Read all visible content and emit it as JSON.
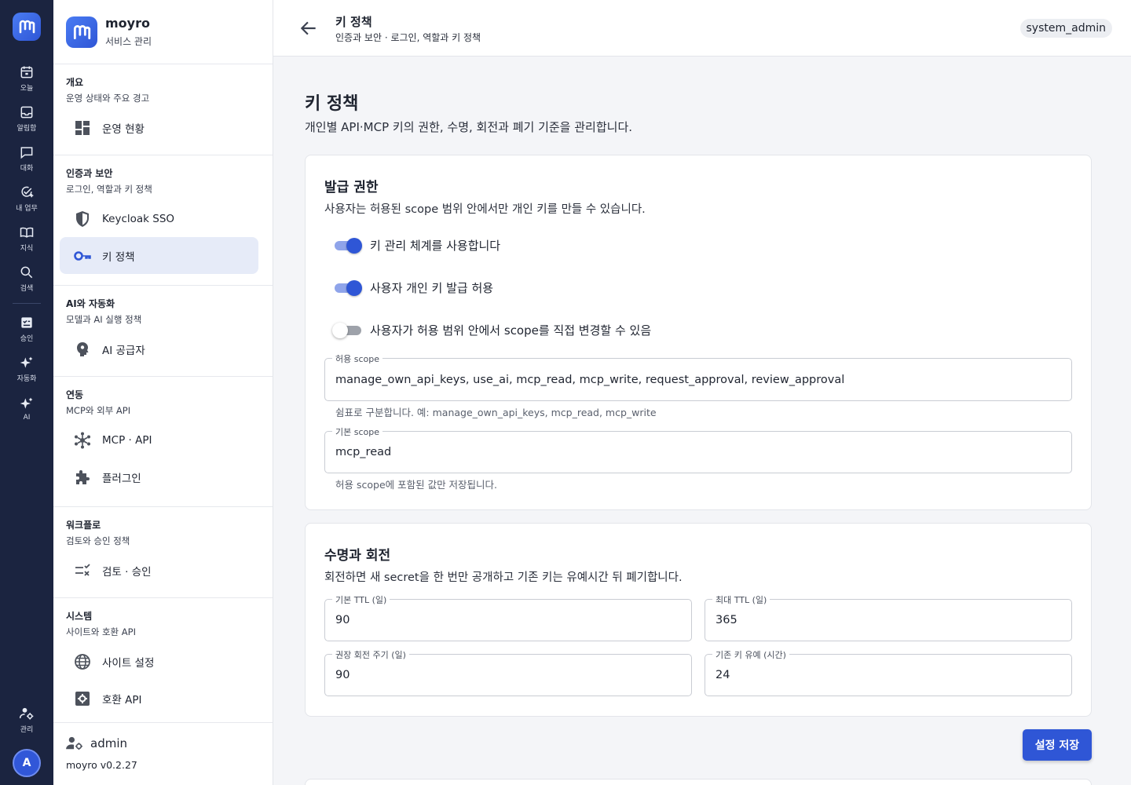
{
  "rail": {
    "items": [
      {
        "label": "오늘",
        "icon": "calendar-icon"
      },
      {
        "label": "알림함",
        "icon": "inbox-icon"
      },
      {
        "label": "대화",
        "icon": "chat-icon"
      },
      {
        "label": "내 업무",
        "icon": "task-check-icon"
      },
      {
        "label": "지식",
        "icon": "book-icon"
      },
      {
        "label": "검색",
        "icon": "search-icon"
      },
      {
        "label": "승인",
        "icon": "approval-icon"
      },
      {
        "label": "자동화",
        "icon": "sparkle-icon"
      },
      {
        "label": "AI",
        "icon": "sparkle-icon"
      }
    ],
    "admin_label": "관리",
    "avatar_initial": "A"
  },
  "sidebar": {
    "brand_name": "moyro",
    "brand_sub": "서비스 관리",
    "sections": [
      {
        "title": "개요",
        "sub": "운영 상태와 주요 경고",
        "items": [
          {
            "label": "운영 현황",
            "icon": "dashboard-icon"
          }
        ]
      },
      {
        "title": "인증과 보안",
        "sub": "로그인, 역할과 키 정책",
        "items": [
          {
            "label": "Keycloak SSO",
            "icon": "shield-icon"
          },
          {
            "label": "키 정책",
            "icon": "key-icon",
            "active": true
          }
        ]
      },
      {
        "title": "AI와 자동화",
        "sub": "모델과 AI 실행 정책",
        "items": [
          {
            "label": "AI 공급자",
            "icon": "brain-icon"
          }
        ]
      },
      {
        "title": "연동",
        "sub": "MCP와 외부 API",
        "items": [
          {
            "label": "MCP · API",
            "icon": "hub-icon"
          },
          {
            "label": "플러그인",
            "icon": "puzzle-icon"
          }
        ]
      },
      {
        "title": "워크플로",
        "sub": "검토와 승인 정책",
        "items": [
          {
            "label": "검토 · 승인",
            "icon": "checklist-icon"
          }
        ]
      },
      {
        "title": "시스템",
        "sub": "사이트와 호환 API",
        "items": [
          {
            "label": "사이트 설정",
            "icon": "globe-icon"
          },
          {
            "label": "호환 API",
            "icon": "settings-box-icon"
          }
        ]
      }
    ],
    "footer_user": "admin",
    "footer_version": "moyro v0.2.27"
  },
  "header": {
    "title": "키 정책",
    "breadcrumb": "인증과 보안 · 로그인, 역할과 키 정책",
    "role": "system_admin"
  },
  "main": {
    "title": "키 정책",
    "desc": "개인별 API·MCP 키의 권한, 수명, 회전과 폐기 기준을 관리합니다.",
    "issue": {
      "title": "발급 권한",
      "desc": "사용자는 허용된 scope 범위 안에서만 개인 키를 만들 수 있습니다.",
      "toggles": [
        {
          "label": "키 관리 체계를 사용합니다",
          "on": true
        },
        {
          "label": "사용자 개인 키 발급 허용",
          "on": true
        },
        {
          "label": "사용자가 허용 범위 안에서 scope를 직접 변경할 수 있음",
          "on": false
        }
      ],
      "allowed_scope_label": "허용 scope",
      "allowed_scope_value": "manage_own_api_keys, use_ai, mcp_read, mcp_write, request_approval, review_approval",
      "allowed_scope_helper": "쉼표로 구분합니다. 예: manage_own_api_keys, mcp_read, mcp_write",
      "default_scope_label": "기본 scope",
      "default_scope_value": "mcp_read",
      "default_scope_helper": "허용 scope에 포함된 값만 저장됩니다."
    },
    "lifetime": {
      "title": "수명과 회전",
      "desc": "회전하면 새 secret을 한 번만 공개하고 기존 키는 유예시간 뒤 폐기합니다.",
      "default_ttl_label": "기본 TTL (일)",
      "default_ttl_value": "90",
      "max_ttl_label": "최대 TTL (일)",
      "max_ttl_value": "365",
      "rotation_label": "권장 회전 주기 (일)",
      "rotation_value": "90",
      "grace_label": "기존 키 유예 (시간)",
      "grace_value": "24"
    },
    "save_label": "설정 저장"
  },
  "colors": {
    "rail_bg": "#1b2440",
    "accent": "#2f56d6",
    "active_nav_bg": "#e6ebf8"
  }
}
